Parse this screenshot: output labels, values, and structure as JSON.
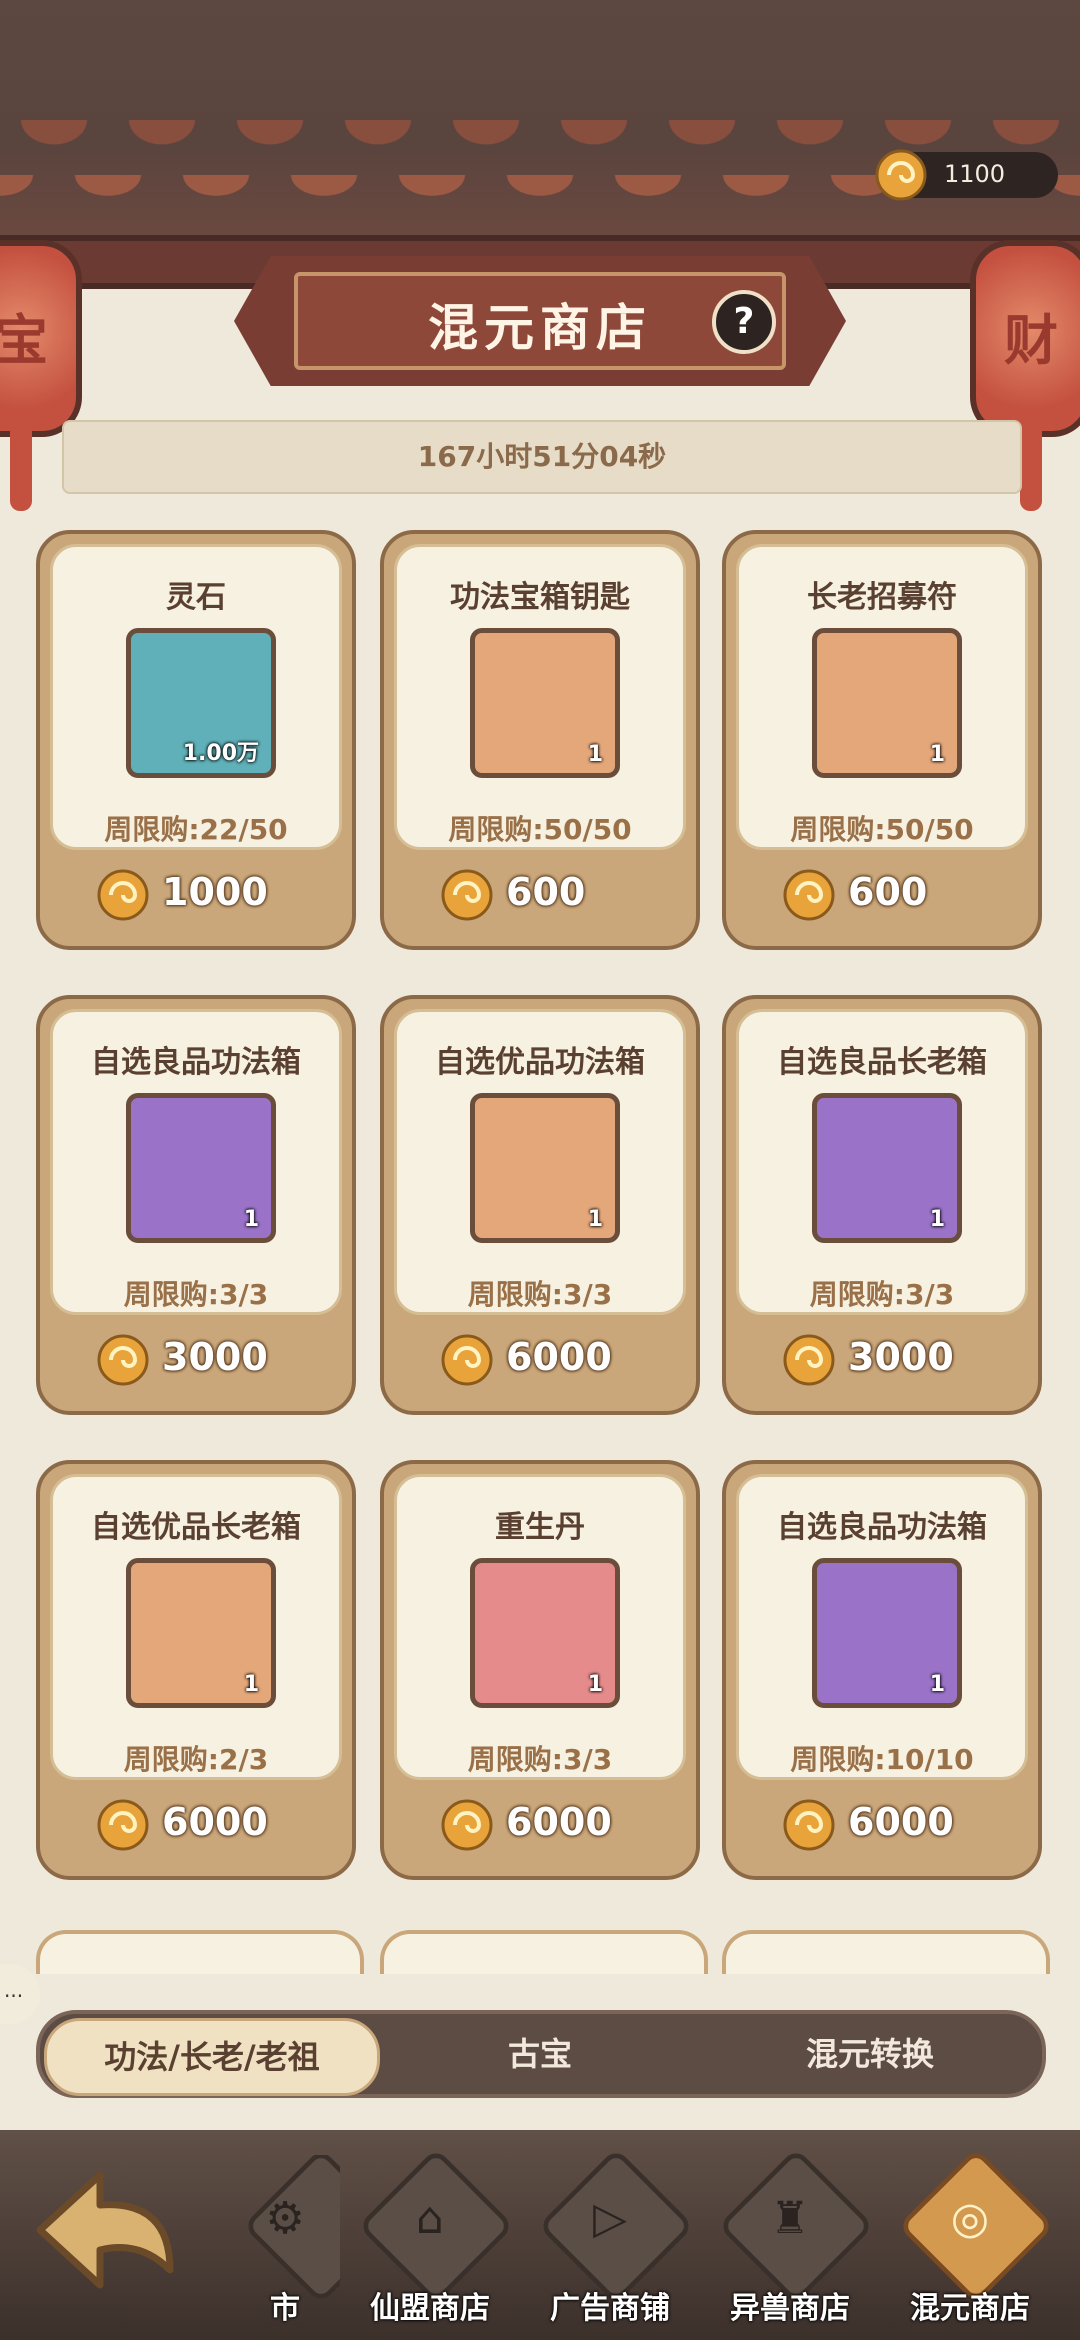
{
  "header": {
    "currency_amount": "1100",
    "title": "混元商店",
    "help_label": "?",
    "timer": "167小时51分04秒",
    "lantern_left_glyph": "宝",
    "lantern_right_glyph": "财"
  },
  "items": [
    {
      "name": "灵石",
      "qty": "1.00万",
      "limit": "周限购:22/50",
      "price": "1000",
      "icon": "spirit-stone-icon",
      "bg": "#5fb0b8"
    },
    {
      "name": "功法宝箱钥匙",
      "qty": "1",
      "limit": "周限购:50/50",
      "price": "600",
      "icon": "golden-key-icon",
      "bg": "#e4a77a"
    },
    {
      "name": "长老招募符",
      "qty": "1",
      "limit": "周限购:50/50",
      "price": "600",
      "icon": "talisman-icon",
      "bg": "#e4a77a"
    },
    {
      "name": "自选良品功法箱",
      "qty": "1",
      "limit": "周限购:3/3",
      "price": "3000",
      "icon": "treasure-chest-icon",
      "bg": "#9a73c8"
    },
    {
      "name": "自选优品功法箱",
      "qty": "1",
      "limit": "周限购:3/3",
      "price": "6000",
      "icon": "treasure-chest-icon",
      "bg": "#e4a77a"
    },
    {
      "name": "自选良品长老箱",
      "qty": "1",
      "limit": "周限购:3/3",
      "price": "3000",
      "icon": "puzzle-chest-icon",
      "bg": "#9a73c8"
    },
    {
      "name": "自选优品长老箱",
      "qty": "1",
      "limit": "周限购:2/3",
      "price": "6000",
      "icon": "puzzle-chest-icon",
      "bg": "#e4a77a"
    },
    {
      "name": "重生丹",
      "qty": "1",
      "limit": "周限购:3/3",
      "price": "6000",
      "icon": "rebirth-pill-icon",
      "bg": "#e58b8b"
    },
    {
      "name": "自选良品功法箱",
      "qty": "1",
      "limit": "周限购:10/10",
      "price": "6000",
      "icon": "treasure-chest-icon",
      "bg": "#9a73c8"
    }
  ],
  "category_tabs": [
    {
      "label": "功法/长老/老祖",
      "active": true
    },
    {
      "label": "古宝",
      "active": false
    },
    {
      "label": "混元转换",
      "active": false
    }
  ],
  "chat_bubble": "···",
  "bottom_nav": [
    {
      "label": "市",
      "icon": "market-icon",
      "active": false
    },
    {
      "label": "仙盟商店",
      "icon": "guild-shop-icon",
      "active": false
    },
    {
      "label": "广告商铺",
      "icon": "video-ad-icon",
      "active": false
    },
    {
      "label": "异兽商店",
      "icon": "beast-shop-icon",
      "active": false
    },
    {
      "label": "混元商店",
      "icon": "hunyuan-orb-icon",
      "active": true
    }
  ],
  "colors": {
    "accent": "#d39a4f",
    "card_frame": "#c9a77a",
    "title_plate": "#8d4839"
  }
}
